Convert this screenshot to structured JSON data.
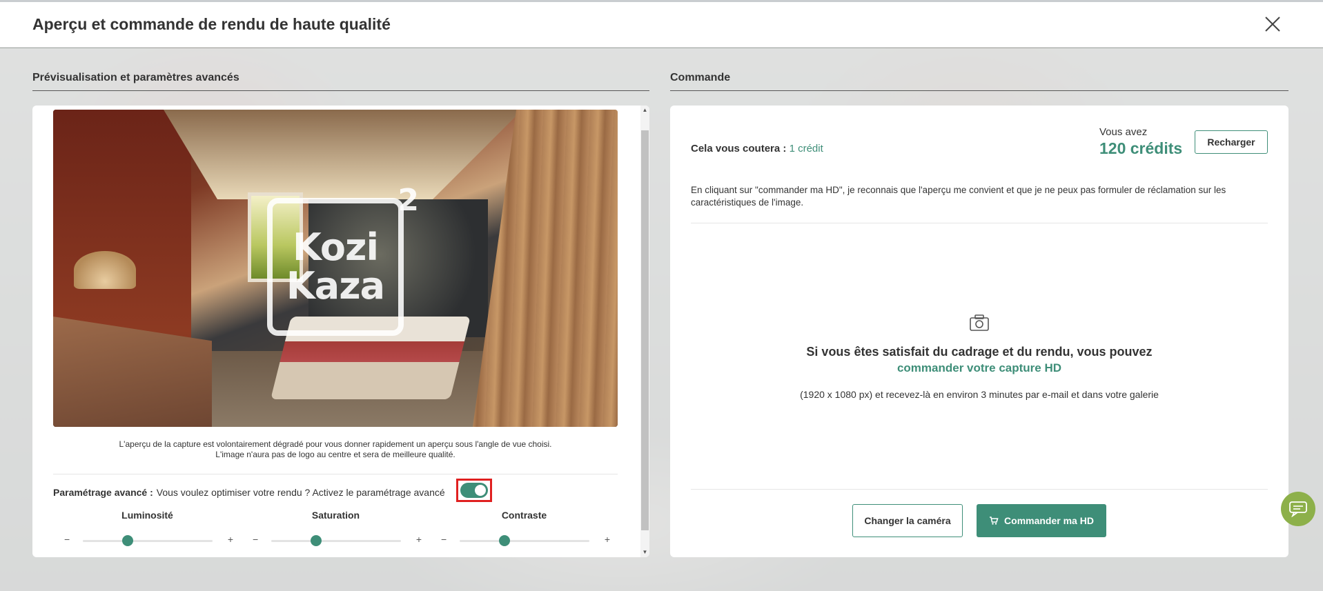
{
  "modal": {
    "title": "Aperçu et commande de rendu de haute qualité"
  },
  "left": {
    "section_title": "Prévisualisation et paramètres avancés",
    "preview_note_line1": "L'aperçu de la capture est volontairement dégradé pour vous donner rapidement un aperçu sous l'angle de vue choisi.",
    "preview_note_line2": "L'image n'aura pas de logo au centre et sera de meilleure qualité.",
    "advanced_label": "Paramétrage avancé :",
    "advanced_text": "Vous voulez optimiser votre rendu ? Activez le paramétrage avancé",
    "advanced_enabled": true,
    "logo_line1": "Kozi",
    "logo_line2": "Kaza",
    "logo_sup": "2",
    "sliders": [
      {
        "label": "Luminosité",
        "minus": "−",
        "plus": "+"
      },
      {
        "label": "Saturation",
        "minus": "−",
        "plus": "+"
      },
      {
        "label": "Contraste",
        "minus": "−",
        "plus": "+"
      }
    ]
  },
  "right": {
    "section_title": "Commande",
    "cost_label": "Cela vous coutera :",
    "cost_value": "1 crédit",
    "credits_label": "Vous avez",
    "credits_value": "120 crédits",
    "reload_label": "Recharger",
    "disclaimer": "En cliquant sur \"commander ma HD\", je reconnais que l'aperçu me convient et que je ne peux pas formuler de réclamation sur les caractéristiques de l'image.",
    "cta_line1": "Si vous êtes satisfait du cadrage et du rendu, vous pouvez",
    "cta_line2": "commander votre capture HD",
    "cta_sub": "(1920 x 1080 px) et recevez-là en environ 3 minutes par e-mail et dans votre galerie",
    "change_camera_label": "Changer la caméra",
    "order_label": "Commander ma HD"
  },
  "colors": {
    "accent": "#3e8e78",
    "chat": "#8db04a",
    "highlight": "#e02020"
  }
}
